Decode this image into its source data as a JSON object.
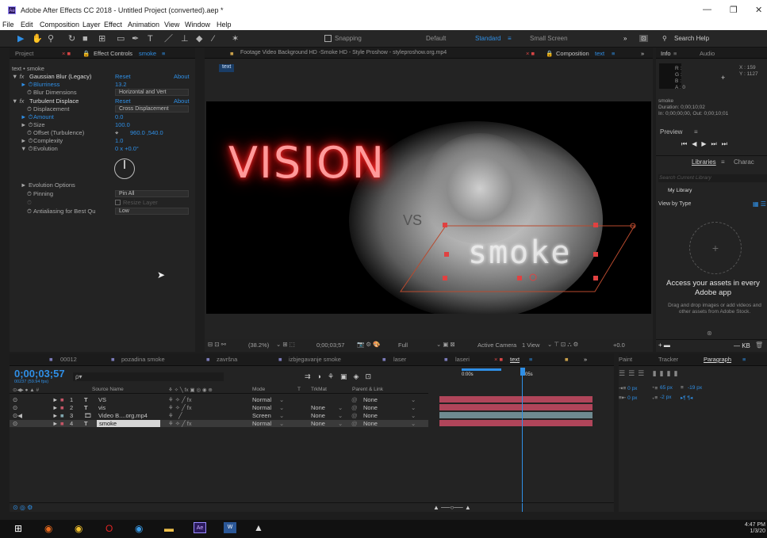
{
  "window": {
    "title": "Adobe After Effects CC 2018 - Untitled Project (converted).aep *",
    "icon": "Ae"
  },
  "menu": [
    "File",
    "Edit",
    "Composition",
    "Layer",
    "Effect",
    "Animation",
    "View",
    "Window",
    "Help"
  ],
  "toolbar": {
    "snapping": "Snapping",
    "workspaces": [
      "Default",
      "Standard",
      "Small Screen"
    ],
    "active_workspace": "Standard",
    "search_placeholder": "Search Help"
  },
  "left_panel": {
    "tab_project": "Project",
    "tab_effect_controls": "Effect Controls",
    "effect_controls_target": "smoke",
    "breadcrumb": "text • smoke",
    "rows": [
      {
        "name": "Gaussian Blur (Legacy)",
        "a": "Reset",
        "b": "About"
      },
      {
        "name": "Blurriness",
        "value": "13.2"
      },
      {
        "name": "Blur Dimensions",
        "value": "Horizontal and Vert"
      },
      {
        "name": "Turbulent Displace",
        "a": "Reset",
        "b": "About"
      },
      {
        "name": "Displacement",
        "value": "Cross Displacement"
      },
      {
        "name": "Amount",
        "value": "0.0"
      },
      {
        "name": "Size",
        "value": "100.0"
      },
      {
        "name": "Offset (Turbulence)",
        "value": "960.0 ,540.0"
      },
      {
        "name": "Complexity",
        "value": "1.0"
      },
      {
        "name": "Evolution",
        "value": "0 x +0.0°"
      },
      {
        "name": "Evolution Options"
      },
      {
        "name": "Pinning",
        "value": "Pin All"
      },
      {
        "name": "",
        "value": "Resize Layer"
      },
      {
        "name": "Antialiasing for Best Qu",
        "value": "Low"
      }
    ]
  },
  "viewer": {
    "tab_footage": "Footage Video Background HD -Smoke HD - Style Proshow - styleproshow.org.mp4",
    "tab_composition": "Composition",
    "comp_name": "text",
    "chip": "text",
    "text_vision": "VISION",
    "text_vs": "VS",
    "text_smoke": "smoke",
    "bar": {
      "zoom": "(38.2%)",
      "time": "0;00;03;57",
      "quality": "Full",
      "camera": "Active Camera",
      "views": "1 View",
      "exposure": "+0.0"
    }
  },
  "right_panel": {
    "tab_info": "Info",
    "tab_audio": "Audio",
    "rgb": [
      "R :",
      "G :",
      "B :",
      "A : 0"
    ],
    "x": "X : 159",
    "y": "Y : 1127",
    "info_lines": [
      "smoke",
      "Duration: 0;00;10;02",
      "In: 0;00;00;00, Out: 0;00;10;01"
    ],
    "preview": "Preview",
    "libraries": "Libraries",
    "charac": "Charac",
    "search_placeholder": "Search Current Library",
    "my_library": "My Library",
    "view_by": "View by Type",
    "promo_title": "Access your assets in every Adobe app",
    "promo_text": "Drag and drop images or add videos and other assets from Adobe Stock.",
    "kb": "— KB"
  },
  "timeline": {
    "tabs": [
      "00012",
      "pozadina smoke",
      "završna",
      "izbjegavanje smoke",
      "laser",
      "laseri",
      "text"
    ],
    "active_tab": "text",
    "current_time": "0;00;03;57",
    "fps": "00237 (59.94 fps)",
    "search_placeholder": "ρ▾",
    "columns": {
      "source": "Source Name",
      "mode": "Mode",
      "t": "T",
      "trkmat": "TrkMat",
      "parent": "Parent & Link"
    },
    "time_marks": [
      "0:00s",
      "05s"
    ],
    "layers": [
      {
        "num": "1",
        "type": "T",
        "name": "VS",
        "mode": "Normal",
        "trkmat": "",
        "parent": "None",
        "color": "#b0455a"
      },
      {
        "num": "2",
        "type": "T",
        "name": "vis",
        "mode": "Normal",
        "trkmat": "None",
        "parent": "None",
        "color": "#b0455a"
      },
      {
        "num": "3",
        "type": "F",
        "name": "Video B....org.mp4",
        "mode": "Screen",
        "trkmat": "None",
        "parent": "None",
        "color": "#6f8a90"
      },
      {
        "num": "4",
        "type": "T",
        "name": "smoke",
        "mode": "Normal",
        "trkmat": "None",
        "parent": "None",
        "color": "#b0455a"
      }
    ]
  },
  "tl_right": {
    "tabs": [
      "Paint",
      "Tracker",
      "Paragraph"
    ],
    "active": "Paragraph",
    "px_values": [
      "0 px",
      "65 px",
      "-19 px",
      "0 px",
      "-2 px"
    ]
  },
  "taskbar": {
    "time": "4:47 PM",
    "date": "1/3/20"
  }
}
